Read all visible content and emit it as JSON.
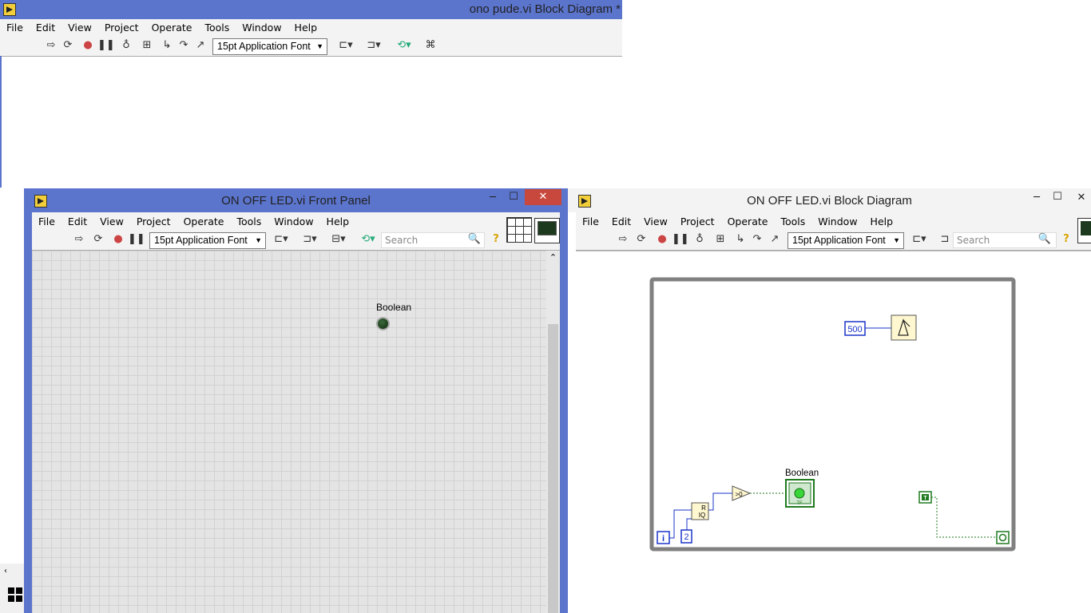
{
  "bg_window": {
    "title": "ono pude.vi Block Diagram *",
    "menu": [
      "File",
      "Edit",
      "View",
      "Project",
      "Operate",
      "Tools",
      "Window",
      "Help"
    ],
    "font_select": "15pt Application Font"
  },
  "front_panel": {
    "title": "ON OFF LED.vi Front Panel",
    "menu": [
      "File",
      "Edit",
      "View",
      "Project",
      "Operate",
      "Tools",
      "Window",
      "Help"
    ],
    "font_select": "15pt Application Font",
    "search_placeholder": "Search",
    "boolean_label": "Boolean"
  },
  "block_diagram": {
    "title": "ON OFF LED.vi Block Diagram",
    "menu": [
      "File",
      "Edit",
      "View",
      "Project",
      "Operate",
      "Tools",
      "Window",
      "Help"
    ],
    "font_select": "15pt Application Font",
    "search_placeholder": "Search",
    "wait_constant": "500",
    "divisor_constant": "2",
    "iteration_terminal": "i",
    "compare_label": ">0",
    "quotient_label_r": "R",
    "quotient_label_iq": "IQ",
    "boolean_label": "Boolean",
    "indicator_tf": "TF",
    "true_constant": "T"
  },
  "colors": {
    "titlebar": "#5b74cc",
    "close": "#c9483d",
    "int_wire": "#1a35c8",
    "bool_wire": "#1f7a1f"
  }
}
